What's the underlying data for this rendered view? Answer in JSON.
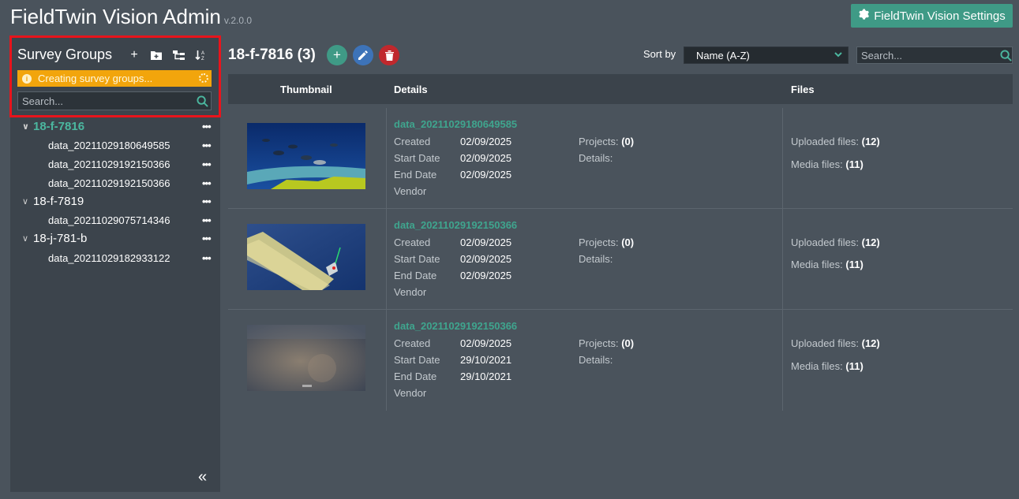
{
  "app": {
    "title": "FieldTwin Vision Admin",
    "version": "v.2.0.0",
    "settings_label": "FieldTwin Vision Settings"
  },
  "sidebar": {
    "title": "Survey Groups",
    "status_text": "Creating survey groups...",
    "search_placeholder": "Search...",
    "groups": [
      {
        "name": "18-f-7816",
        "children": [
          "data_20211029180649585",
          "data_20211029192150366",
          "data_20211029192150366"
        ]
      },
      {
        "name": "18-f-7819",
        "children": [
          "data_20211029075714346"
        ]
      },
      {
        "name": "18-j-781-b",
        "children": [
          "data_20211029182933122"
        ]
      }
    ],
    "collapse_glyph": "«"
  },
  "main": {
    "group_title": "18-f-7816 (3)",
    "sort_label": "Sort by",
    "sort_value": "Name (A-Z)",
    "search_placeholder": "Search...",
    "columns": {
      "thumbnail": "Thumbnail",
      "details": "Details",
      "files": "Files"
    },
    "labels": {
      "created": "Created",
      "start": "Start Date",
      "end": "End Date",
      "vendor": "Vendor",
      "projects": "Projects:",
      "details": "Details:",
      "uploaded": "Uploaded files:",
      "media": "Media files:"
    },
    "rows": [
      {
        "name": "data_20211029180649585",
        "created": "02/09/2025",
        "start": "02/09/2025",
        "end": "02/09/2025",
        "projects": "(0)",
        "uploaded": "(12)",
        "media": "(11)"
      },
      {
        "name": "data_20211029192150366",
        "created": "02/09/2025",
        "start": "02/09/2025",
        "end": "02/09/2025",
        "projects": "(0)",
        "uploaded": "(12)",
        "media": "(11)"
      },
      {
        "name": "data_20211029192150366",
        "created": "02/09/2025",
        "start": "29/10/2021",
        "end": "29/10/2021",
        "projects": "(0)",
        "uploaded": "(12)",
        "media": "(11)"
      }
    ]
  },
  "colors": {
    "accent": "#3f9a86",
    "link": "#3fa58e",
    "warning": "#f2a50c",
    "edit": "#3d73b8",
    "delete": "#c0282d",
    "highlight": "#e8141c"
  }
}
